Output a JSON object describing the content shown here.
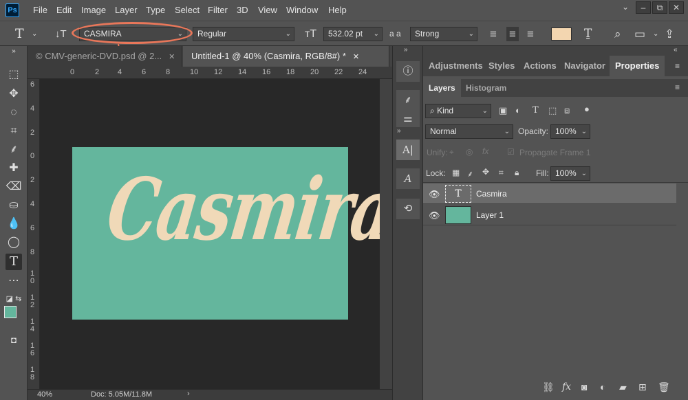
{
  "menu": [
    "File",
    "Edit",
    "Image",
    "Layer",
    "Type",
    "Select",
    "Filter",
    "3D",
    "View",
    "Window",
    "Help"
  ],
  "app_logo": "Ps",
  "window_controls": [
    "⌄",
    "–",
    "⧉",
    "✕"
  ],
  "options": {
    "font_family": "CASMIRA",
    "font_style": "Regular",
    "font_size": "532.02 pt",
    "aa_label": "a a",
    "anti_alias": "Strong",
    "text_color": "#f3d6b0",
    "highlight_color": "#e9775a"
  },
  "tabs": [
    {
      "label": "© CMV-generic-DVD.psd @ 2...",
      "close": "✕",
      "active": false
    },
    {
      "label": "Untitled-1 @ 40% (Casmira, RGB/8#) *",
      "close": "✕",
      "active": true
    }
  ],
  "ruler_top": [
    "0",
    "2",
    "4",
    "6",
    "8",
    "10",
    "12",
    "14",
    "16",
    "18",
    "20",
    "22",
    "24"
  ],
  "ruler_left": [
    "6",
    "4",
    "2",
    "0",
    "2",
    "4",
    "6",
    "8",
    "1\n0",
    "1\n2",
    "1\n4",
    "1\n6",
    "1\n8"
  ],
  "canvas": {
    "text": "Casmira",
    "background": "#64b69d",
    "text_color": "#f0d9b8"
  },
  "status": {
    "zoom": "40%",
    "doc": "Doc: 5.05M/11.8M",
    "arrow": "›"
  },
  "panel_tabs": [
    "Adjustments",
    "Styles",
    "Actions",
    "Navigator",
    "Properties"
  ],
  "layer_tabs": [
    "Layers",
    "Histogram"
  ],
  "layers_panel": {
    "kind_label": "Kind",
    "blend_mode": "Normal",
    "opacity_label": "Opacity:",
    "opacity": "100%",
    "unify_label": "Unify:",
    "propagate_label": "Propagate Frame 1",
    "lock_label": "Lock:",
    "fill_label": "Fill:",
    "fill": "100%",
    "layers": [
      {
        "name": "Casmira",
        "type": "text",
        "selected": true
      },
      {
        "name": "Layer 1",
        "type": "fill",
        "selected": false,
        "color": "#64b69d"
      }
    ]
  }
}
